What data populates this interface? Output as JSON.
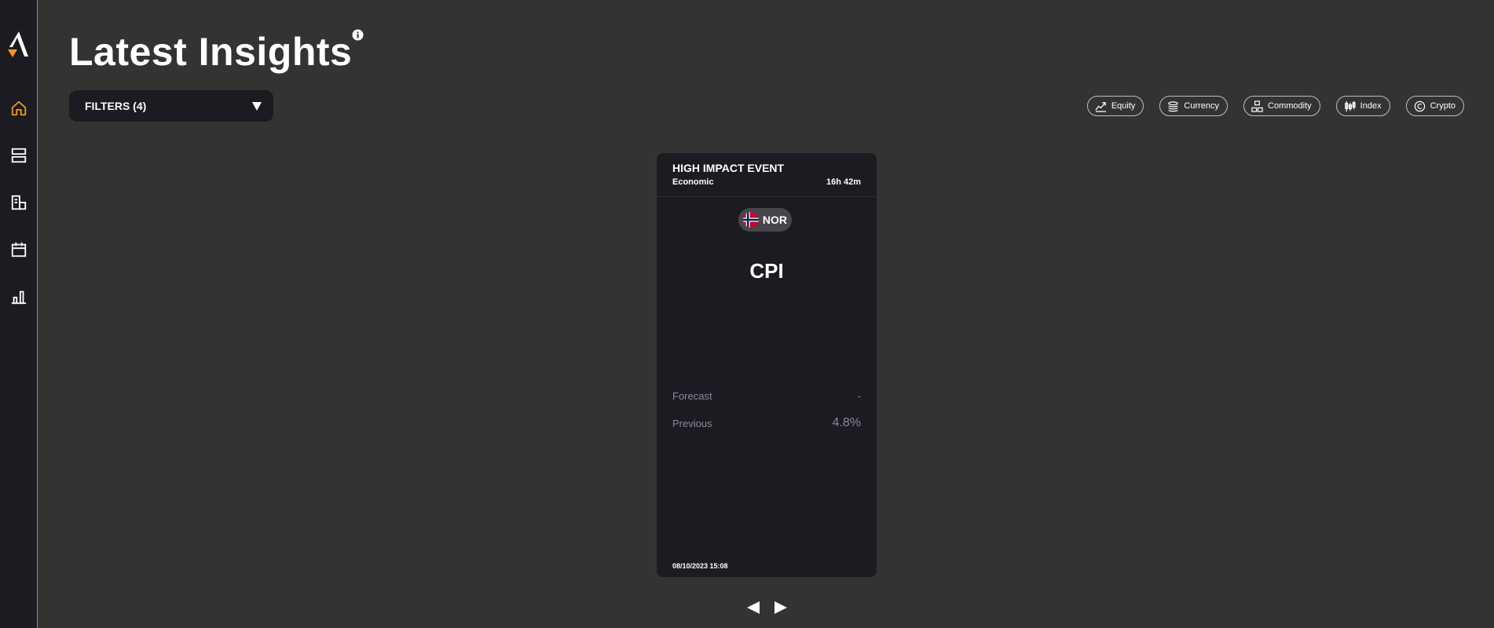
{
  "page": {
    "title": "Latest Insights",
    "filters_label": "FILTERS (4)"
  },
  "asset_filters": [
    {
      "label": "Equity",
      "icon": "equity-icon"
    },
    {
      "label": "Currency",
      "icon": "currency-icon"
    },
    {
      "label": "Commodity",
      "icon": "commodity-icon"
    },
    {
      "label": "Index",
      "icon": "index-icon"
    },
    {
      "label": "Crypto",
      "icon": "crypto-icon"
    }
  ],
  "sidebar": {
    "items": [
      {
        "name": "home",
        "icon": "home-icon",
        "active": true
      },
      {
        "name": "feed",
        "icon": "layers-icon"
      },
      {
        "name": "reports",
        "icon": "document-icon"
      },
      {
        "name": "calendar",
        "icon": "calendar-icon"
      },
      {
        "name": "analytics",
        "icon": "bar-chart-icon"
      }
    ]
  },
  "card": {
    "event_title": "HIGH IMPACT EVENT",
    "category": "Economic",
    "countdown": "16h 42m",
    "country": "NOR",
    "indicator": "CPI",
    "forecast_label": "Forecast",
    "forecast_value": "-",
    "previous_label": "Previous",
    "previous_value": "4.8%",
    "date": "08/10/2023 15:08"
  },
  "colors": {
    "background": "#333333",
    "panel": "#1b1b21",
    "accent": "#f7941d",
    "muted_text": "#8a8a96"
  }
}
